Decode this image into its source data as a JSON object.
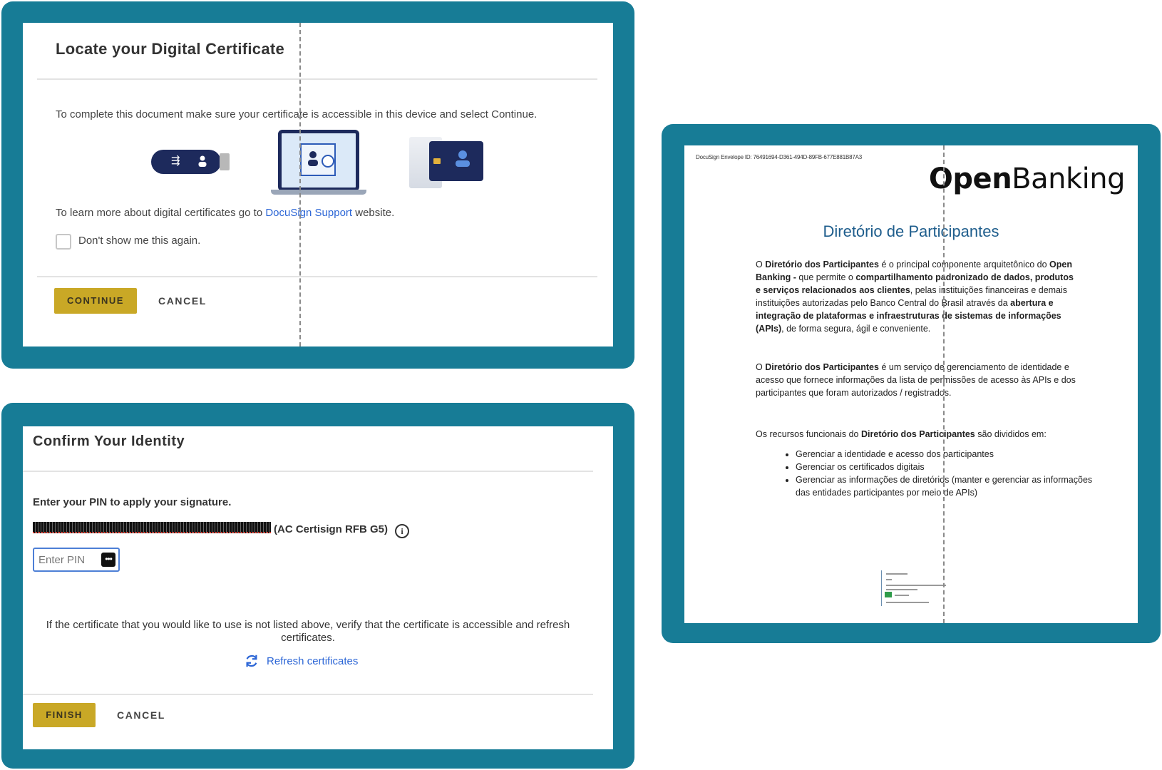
{
  "locate_dialog": {
    "title": "Locate your Digital Certificate",
    "instruction": "To complete this document make sure your certificate is accessible in this device and select Continue.",
    "learn_prefix": "To learn more about digital certificates go to ",
    "learn_link": "DocuSign Support",
    "learn_suffix": " website.",
    "checkbox_label": "Don't show me this again.",
    "checkbox_checked": false,
    "continue_label": "CONTINUE",
    "cancel_label": "CANCEL",
    "icons": [
      "usb-token-icon",
      "laptop-certificate-icon",
      "smart-card-reader-icon"
    ]
  },
  "confirm_dialog": {
    "title": "Confirm Your Identity",
    "subtitle": "Enter your PIN to apply your signature.",
    "certificate_name": "(AC Certisign RFB G5)",
    "pin_placeholder": "Enter PIN",
    "pin_value": "",
    "note": "If the certificate that you would like to use is not listed above, verify that the certificate is accessible and refresh certificates.",
    "refresh_label": "Refresh certificates",
    "finish_label": "FINISH",
    "cancel_label": "CANCEL"
  },
  "document": {
    "envelope_id": "DocuSign Envelope ID: 76491694-D361-494D-89FB-677E881B87A3",
    "logo_open": "Open",
    "logo_banking": "Banking",
    "title": "Diretório de Participantes",
    "p1_t1": "O ",
    "p1_b1": "Diretório dos Participantes",
    "p1_t2": " é o principal componente arquitetônico do ",
    "p1_b2": "Open Banking -",
    "p1_t3": " que permite o ",
    "p1_b3": "compartilhamento padronizado de dados, produtos e serviços relacionados aos clientes",
    "p1_t4": ", pelas instituições financeiras e demais instituições autorizadas pelo Banco Central do Brasil através da ",
    "p1_b4": "abertura e integração de plataformas e infraestruturas de sistemas de informações (APIs)",
    "p1_t5": ", de forma segura, ágil e conveniente.",
    "p2_t1": "O ",
    "p2_b1": "Diretório dos Participantes",
    "p2_t2": " é um serviço de gerenciamento de identidade e acesso que fornece informações da lista de permissões de acesso às APIs e dos participantes que foram autorizados / registrados.",
    "p3_t1": "Os recursos funcionais do ",
    "p3_b1": "Diretório dos Participantes",
    "p3_t2": " são divididos em:",
    "bullets": [
      "Gerenciar a identidade e acesso dos participantes",
      "Gerenciar os certificados digitais",
      "Gerenciar as informações de diretórios (manter e gerenciar as informações das entidades participantes por meio de APIs)"
    ]
  },
  "colors": {
    "frame": "#177c96",
    "button_gold": "#c9a826",
    "link_blue": "#2c66d6",
    "doc_title": "#1e5d8c"
  }
}
